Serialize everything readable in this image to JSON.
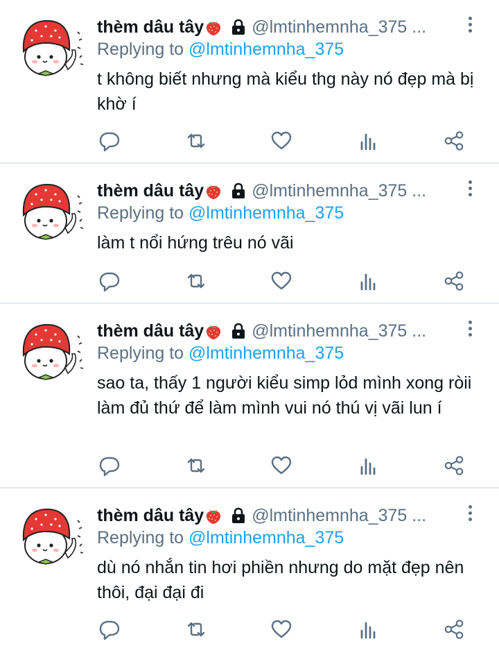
{
  "tweets": [
    {
      "display_name": "thèm dâu tây",
      "handle": "@lmtinhemnha_375 ...",
      "replying_prefix": "Replying to",
      "replying_to": "@lmtinhemnha_375",
      "text": "t không biết nhưng mà kiểu thg này nó đẹp mà bị khờ í"
    },
    {
      "display_name": "thèm dâu tây",
      "handle": "@lmtinhemnha_375 ...",
      "replying_prefix": "Replying to",
      "replying_to": "@lmtinhemnha_375",
      "text": "làm t nổi hứng trêu nó vãi"
    },
    {
      "display_name": "thèm dâu tây",
      "handle": "@lmtinhemnha_375 ...",
      "replying_prefix": "Replying to",
      "replying_to": "@lmtinhemnha_375",
      "text": "sao ta, thấy 1 người kiểu simp lỏd mình xong ròii làm đủ thứ để làm mình vui nó thú vị vãi lun í"
    },
    {
      "display_name": "thèm dâu tây",
      "handle": "@lmtinhemnha_375 ...",
      "replying_prefix": "Replying to",
      "replying_to": "@lmtinhemnha_375",
      "text": "dù nó nhắn tin hơi phiền nhưng do mặt đẹp nên thôi, đại đại đi"
    }
  ],
  "icons": {
    "reply": "reply-icon",
    "retweet": "retweet-icon",
    "like": "heart-icon",
    "analytics": "analytics-icon",
    "share": "share-icon",
    "more": "more-vertical-icon",
    "protected": "lock-icon",
    "emoji": "strawberry-icon"
  },
  "colors": {
    "link": "#1da1f2",
    "secondary_text": "#5b7083",
    "divider": "#e1e8ed",
    "avatar_hat": "#e53935"
  }
}
